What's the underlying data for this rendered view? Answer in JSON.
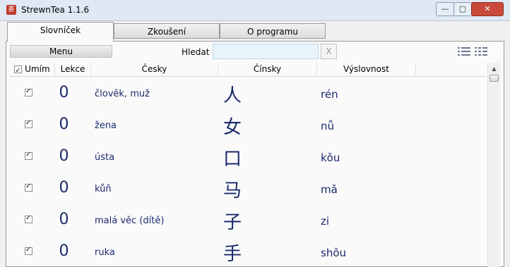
{
  "window": {
    "app_icon_glyph": "茶",
    "title": "StrewnTea 1.1.6",
    "controls": {
      "minimize": "—",
      "maximize": "▢",
      "close": "✕"
    }
  },
  "tabs": [
    {
      "label": "Slovníček",
      "active": true
    },
    {
      "label": "Zkoušení",
      "active": false
    },
    {
      "label": "O programu",
      "active": false
    }
  ],
  "toolbar": {
    "menu_label": "Menu",
    "search_label": "Hledat",
    "search_value": "",
    "clear_label": "X",
    "view_icons": [
      "list-view-icon",
      "grid-view-icon"
    ]
  },
  "table": {
    "columns": [
      "Umím",
      "Lekce",
      "Česky",
      "Čínsky",
      "Výslovnost"
    ],
    "rows": [
      {
        "known": true,
        "lesson": "0",
        "czech": "člověk, muž",
        "chinese": "人",
        "pinyin": "rén"
      },
      {
        "known": true,
        "lesson": "0",
        "czech": "žena",
        "chinese": "女",
        "pinyin": "nǚ"
      },
      {
        "known": true,
        "lesson": "0",
        "czech": "ústa",
        "chinese": "口",
        "pinyin": "kǒu"
      },
      {
        "known": true,
        "lesson": "0",
        "czech": "kůň",
        "chinese": "马",
        "pinyin": "mǎ"
      },
      {
        "known": true,
        "lesson": "0",
        "czech": "malá věc (dítě)",
        "chinese": "子",
        "pinyin": "zi"
      },
      {
        "known": true,
        "lesson": "0",
        "czech": "ruka",
        "chinese": "手",
        "pinyin": "shǒu"
      }
    ]
  },
  "colors": {
    "text_accent": "#1a2a6c",
    "search_bg": "#e8f4fb",
    "close_red": "#c94a3a"
  }
}
